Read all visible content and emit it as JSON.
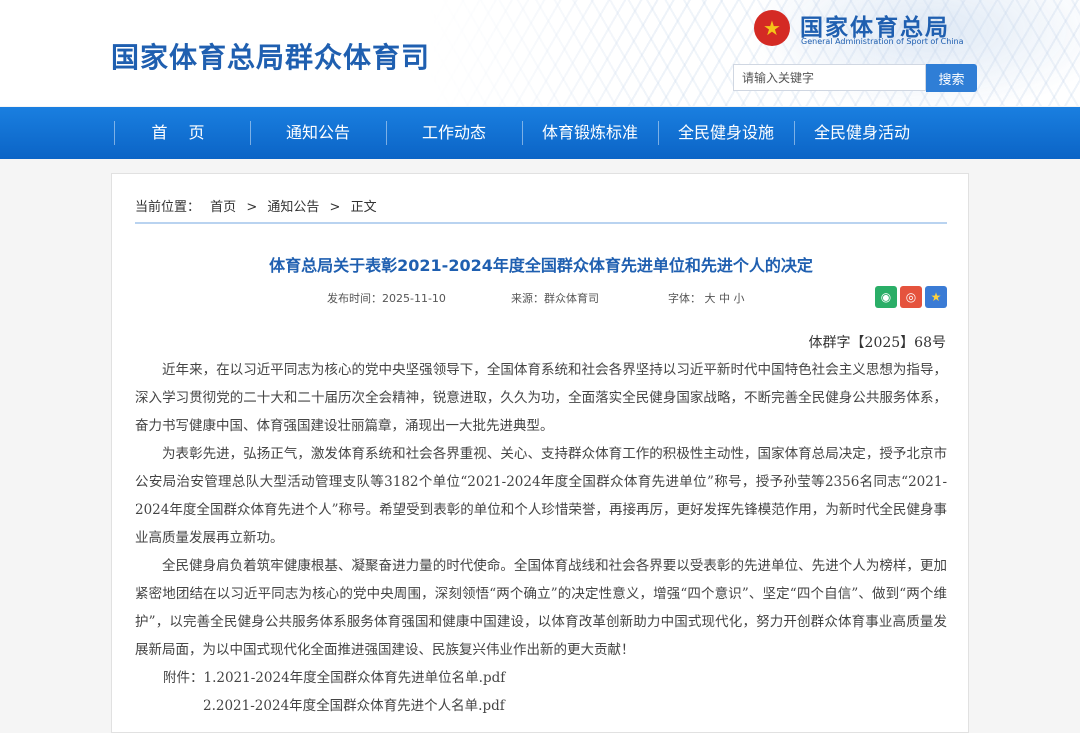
{
  "header": {
    "site_title": "国家体育总局群众体育司",
    "brand_cn": "国家体育总局",
    "brand_en": "General Administration of Sport of China",
    "search_placeholder": "请输入关键字",
    "search_button": "搜索"
  },
  "nav": {
    "items": [
      "首 页",
      "通知公告",
      "工作动态",
      "体育锻炼标准",
      "全民健身设施",
      "全民健身活动"
    ]
  },
  "breadcrumb": {
    "label": "当前位置：",
    "home": "首页",
    "sep": ">",
    "section": "通知公告",
    "current": "正文"
  },
  "article": {
    "title": "体育总局关于表彰2021-2024年度全国群众体育先进单位和先进个人的决定",
    "publish_time": "发布时间：2025-11-10",
    "source": "来源：群众体育司",
    "font_label": "字体：",
    "font_large": "大",
    "font_medium": "中",
    "font_small": "小",
    "doc_number": "体群字【2025】68号",
    "paragraphs": [
      "近年来，在以习近平同志为核心的党中央坚强领导下，全国体育系统和社会各界坚持以习近平新时代中国特色社会主义思想为指导，深入学习贯彻党的二十大和二十届历次全会精神，锐意进取，久久为功，全面落实全民健身国家战略，不断完善全民健身公共服务体系，奋力书写健康中国、体育强国建设壮丽篇章，涌现出一大批先进典型。",
      "为表彰先进，弘扬正气，激发体育系统和社会各界重视、关心、支持群众体育工作的积极性主动性，国家体育总局决定，授予北京市公安局治安管理总队大型活动管理支队等3182个单位“2021-2024年度全国群众体育先进单位”称号，授予孙莹等2356名同志“2021-2024年度全国群众体育先进个人”称号。希望受到表彰的单位和个人珍惜荣誉，再接再厉，更好发挥先锋模范作用，为新时代全民健身事业高质量发展再立新功。",
      "全民健身肩负着筑牢健康根基、凝聚奋进力量的时代使命。全国体育战线和社会各界要以受表彰的先进单位、先进个人为榜样，更加紧密地团结在以习近平同志为核心的党中央周围，深刻领悟“两个确立”的决定性意义，增强“四个意识”、坚定“四个自信”、做到“两个维护”，以完善全民健身公共服务体系服务体育强国和健康中国建设，以体育改革创新助力中国式现代化，努力开创群众体育事业高质量发展新局面，为以中国式现代化全面推进强国建设、民族复兴伟业作出新的更大贡献！"
    ],
    "attachment_label": "附件：",
    "attachments": [
      "1.2021-2024年度全国群众体育先进单位名单.pdf",
      "2.2021-2024年度全国群众体育先进个人名单.pdf"
    ]
  },
  "colors": {
    "brand_blue": "#1f5fb0",
    "nav_blue": "#0b64c6",
    "search_blue": "#2f7ed6"
  },
  "icons": {
    "emblem": "national-emblem-icon",
    "share": [
      "wechat-icon",
      "weibo-icon",
      "favorite-star-icon"
    ]
  }
}
